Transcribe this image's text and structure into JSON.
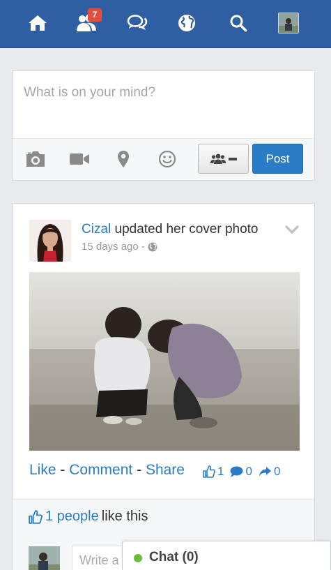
{
  "nav": {
    "items": [
      {
        "icon": "home-icon"
      },
      {
        "icon": "friends-icon",
        "badge": "7"
      },
      {
        "icon": "messages-icon"
      },
      {
        "icon": "globe-icon"
      },
      {
        "icon": "search-icon"
      }
    ],
    "badge_color": "#e74c3c",
    "bar_color": "#2f5ea3"
  },
  "composer": {
    "placeholder": "What is on your mind?",
    "tools": [
      "camera-icon",
      "video-icon",
      "location-icon",
      "smiley-icon"
    ],
    "privacy_icon": "group-icon",
    "post_label": "Post"
  },
  "post": {
    "author": "Cizal",
    "action": "updated her cover photo",
    "time": "15 days ago",
    "separator": "-",
    "audience_icon": "globe-icon",
    "actions": {
      "like": "Like",
      "comment": "Comment",
      "share": "Share",
      "separator": "-"
    },
    "stats": {
      "likes": "1",
      "comments": "0",
      "shares": "0"
    },
    "likes_summary": {
      "count_text": "1 people",
      "suffix": "like this"
    },
    "comment_placeholder": "Write a"
  },
  "chat": {
    "label": "Chat (0)",
    "status_color": "#6cbf3d"
  },
  "colors": {
    "accent": "#2a7cc7",
    "page_bg": "#e9eaed"
  }
}
